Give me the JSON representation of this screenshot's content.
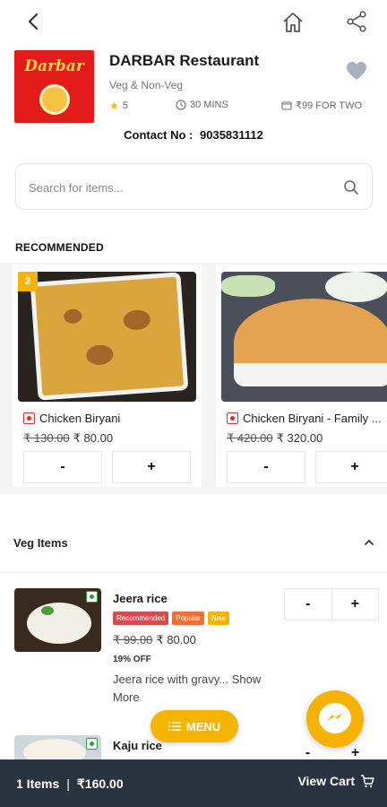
{
  "restaurant": {
    "logo_text": "Darbar",
    "name": "DARBAR Restaurant",
    "type": "Veg & Non-Veg",
    "rating": "5",
    "time": "30 MINS",
    "cost": "₹99 FOR TWO",
    "contact_label": "Contact No :",
    "contact_number": "9035831112"
  },
  "search": {
    "placeholder": "Search for items..."
  },
  "recommended": {
    "title": "RECOMMENDED",
    "items": [
      {
        "badge": "2",
        "name": "Chicken Biryani",
        "old_price": "₹ 130.00",
        "price": "₹ 80.00",
        "minus": "-",
        "plus": "+"
      },
      {
        "name": "Chicken Biryani - Family ...",
        "old_price": "₹ 420.00",
        "price": "₹ 320.00",
        "minus": "-",
        "plus": "+"
      }
    ]
  },
  "veg_section": {
    "title": "Veg Items",
    "items": [
      {
        "name": "Jeera rice",
        "tags": [
          "Recommended",
          "Popular",
          "New"
        ],
        "old_price": "₹ 99.00",
        "price": "₹ 80.00",
        "discount": "19% OFF",
        "description": "Jeera rice with gravy... Show More",
        "minus": "-",
        "plus": "+"
      },
      {
        "name": "Kaju rice",
        "minus": "-",
        "plus": "+"
      }
    ]
  },
  "menu_button": {
    "label": "MENU"
  },
  "cart": {
    "items": "1 Items",
    "separator": "|",
    "total": "₹160.00",
    "view_label": "View Cart"
  },
  "colors": {
    "accent": "#f5b400",
    "cart_bar": "#2a3441",
    "logo_bg": "#e31b1b"
  }
}
